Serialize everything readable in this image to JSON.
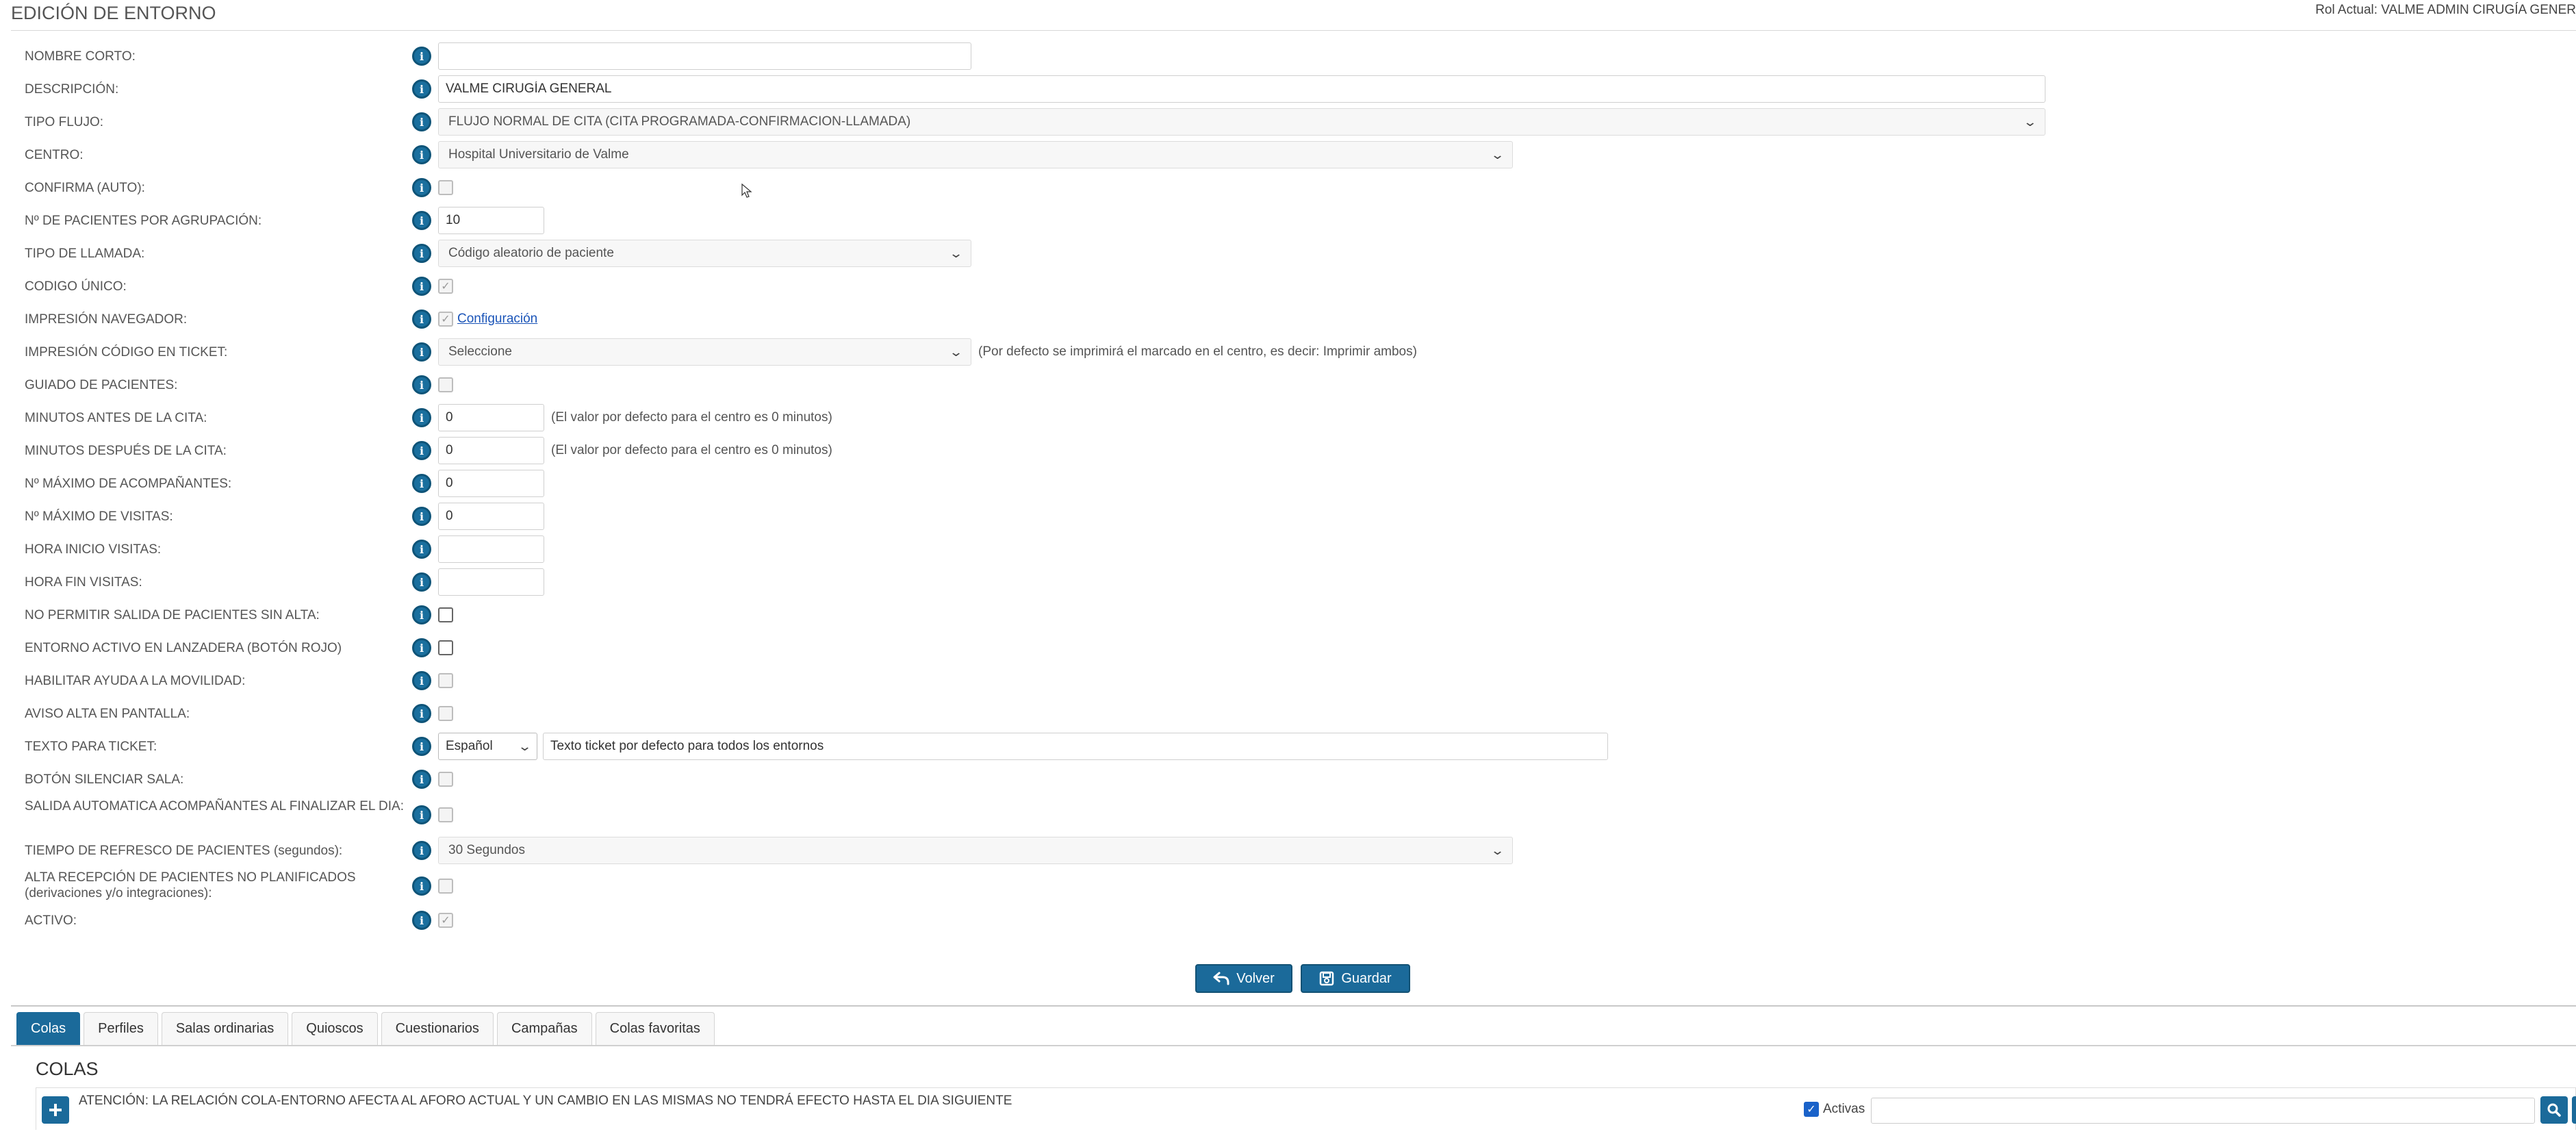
{
  "header": {
    "title": "EDICIÓN DE ENTORNO",
    "rol": "Rol Actual: VALME ADMIN CIRUGÍA GENER"
  },
  "form": {
    "nombre_corto": {
      "label": "NOMBRE CORTO:",
      "value": ""
    },
    "descripcion": {
      "label": "DESCRIPCIÓN:",
      "value": "VALME CIRUGÍA GENERAL"
    },
    "tipo_flujo": {
      "label": "TIPO FLUJO:",
      "value": "FLUJO NORMAL DE CITA (CITA PROGRAMADA-CONFIRMACION-LLAMADA)"
    },
    "centro": {
      "label": "CENTRO:",
      "value": "Hospital Universitario de Valme"
    },
    "confirma_auto": {
      "label": "CONFIRMA (AUTO):",
      "checked": false
    },
    "pacientes_agrupacion": {
      "label": "Nº DE PACIENTES POR AGRUPACIÓN:",
      "value": "10"
    },
    "tipo_llamada": {
      "label": "TIPO DE LLAMADA:",
      "value": "Código aleatorio de paciente"
    },
    "codigo_unico": {
      "label": "CODIGO ÚNICO:",
      "checked": true
    },
    "impresion_navegador": {
      "label": "IMPRESIÓN NAVEGADOR:",
      "checked": true,
      "link": "Configuración"
    },
    "impresion_ticket": {
      "label": "IMPRESIÓN CÓDIGO EN TICKET:",
      "value": "Seleccione",
      "hint": "(Por defecto se imprimirá el marcado en el centro, es decir: Imprimir ambos)"
    },
    "guiado": {
      "label": "GUIADO DE PACIENTES:",
      "checked": false
    },
    "minutos_antes": {
      "label": "MINUTOS ANTES DE LA CITA:",
      "value": "0",
      "hint": "(El valor por defecto para el centro es 0 minutos)"
    },
    "minutos_despues": {
      "label": "MINUTOS DESPUÉS DE LA CITA:",
      "value": "0",
      "hint": "(El valor por defecto para el centro es 0 minutos)"
    },
    "max_acompanantes": {
      "label": "Nº MÁXIMO DE ACOMPAÑANTES:",
      "value": "0"
    },
    "max_visitas": {
      "label": "Nº MÁXIMO DE VISITAS:",
      "value": "0"
    },
    "hora_inicio": {
      "label": "HORA INICIO VISITAS:",
      "value": ""
    },
    "hora_fin": {
      "label": "HORA FIN VISITAS:",
      "value": ""
    },
    "no_permitir_salida": {
      "label": "NO PERMITIR SALIDA DE PACIENTES SIN ALTA:",
      "checked": false
    },
    "entorno_lanzadera": {
      "label": "ENTORNO ACTIVO EN LANZADERA (BOTÓN ROJO)",
      "checked": false
    },
    "ayuda_movilidad": {
      "label": "HABILITAR AYUDA A LA MOVILIDAD:",
      "checked": false
    },
    "aviso_alta": {
      "label": "AVISO ALTA EN PANTALLA:",
      "checked": false
    },
    "texto_ticket": {
      "label": "TEXTO PARA TICKET:",
      "idioma": "Español",
      "value": "Texto ticket por defecto para todos los entornos"
    },
    "boton_silenciar": {
      "label": "BOTÓN SILENCIAR SALA:",
      "checked": false
    },
    "salida_automatica": {
      "label": "SALIDA AUTOMATICA ACOMPAÑANTES AL FINALIZAR EL DIA:",
      "checked": false
    },
    "tiempo_refresco": {
      "label": "TIEMPO DE REFRESCO DE PACIENTES (segundos):",
      "value": "30 Segundos"
    },
    "alta_recepcion": {
      "label": "ALTA RECEPCIÓN DE PACIENTES NO PLANIFICADOS (derivaciones y/o integraciones):",
      "checked": false
    },
    "activo": {
      "label": "ACTIVO:",
      "checked": true
    }
  },
  "buttons": {
    "volver": "Volver",
    "guardar": "Guardar"
  },
  "tabs": [
    {
      "label": "Colas",
      "active": true
    },
    {
      "label": "Perfiles"
    },
    {
      "label": "Salas ordinarias"
    },
    {
      "label": "Quioscos"
    },
    {
      "label": "Cuestionarios"
    },
    {
      "label": "Campañas"
    },
    {
      "label": "Colas favoritas"
    }
  ],
  "colas": {
    "title": "COLAS",
    "warning": "ATENCIÓN: LA RELACIÓN COLA-ENTORNO AFECTA AL AFORO ACTUAL Y UN CAMBIO EN LAS MISMAS NO TENDRÁ EFECTO HASTA EL DIA SIGUIENTE",
    "activas_label": "Activas",
    "activas_checked": true,
    "search_value": ""
  },
  "colors": {
    "primary": "#1b6a9a",
    "link": "#1a54b8"
  }
}
